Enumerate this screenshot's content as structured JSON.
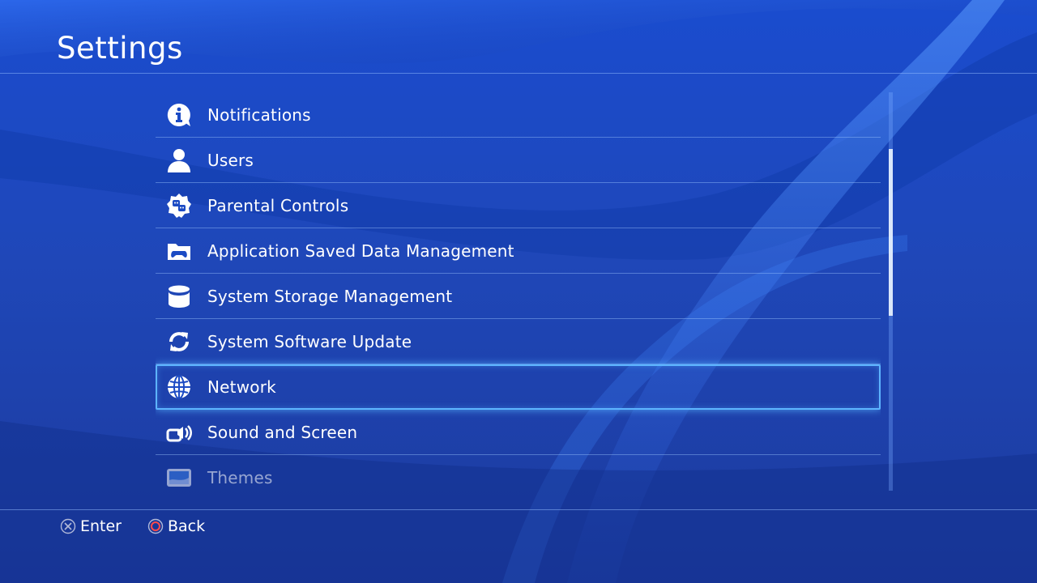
{
  "page": {
    "title": "Settings"
  },
  "menu": {
    "selected_index": 6,
    "items": [
      {
        "label": "Notifications",
        "icon": "info-bubble-icon"
      },
      {
        "label": "Users",
        "icon": "user-icon"
      },
      {
        "label": "Parental Controls",
        "icon": "parental-shield-icon"
      },
      {
        "label": "Application Saved Data Management",
        "icon": "folder-controller-icon"
      },
      {
        "label": "System Storage Management",
        "icon": "storage-cylinder-icon"
      },
      {
        "label": "System Software Update",
        "icon": "update-arrows-icon"
      },
      {
        "label": "Network",
        "icon": "globe-icon"
      },
      {
        "label": "Sound and Screen",
        "icon": "sound-screen-icon"
      },
      {
        "label": "Themes",
        "icon": "themes-icon"
      }
    ]
  },
  "footer": {
    "enter": {
      "label": "Enter",
      "icon": "cross-button-icon"
    },
    "back": {
      "label": "Back",
      "icon": "circle-button-icon"
    }
  },
  "colors": {
    "background": "#1a48c4",
    "selection_outline": "#5db4ff",
    "cross_button": "#b0b8d8",
    "circle_button": "#ff4b4b"
  }
}
